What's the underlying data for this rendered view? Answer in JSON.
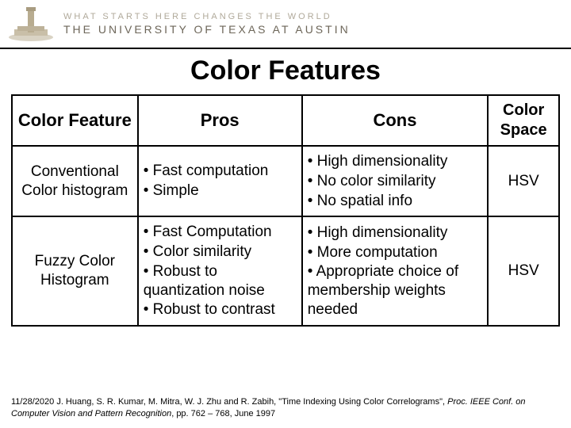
{
  "header": {
    "tagline": "WHAT STARTS HERE CHANGES THE WORLD",
    "university": "THE UNIVERSITY OF TEXAS AT AUSTIN"
  },
  "title": "Color Features",
  "table": {
    "headers": {
      "feature": "Color Feature",
      "pros": "Pros",
      "cons": "Cons",
      "space": "Color Space"
    },
    "rows": [
      {
        "feature": "Conventional Color histogram",
        "pros": [
          "• Fast computation",
          "• Simple"
        ],
        "cons": [
          "• High dimensionality",
          "• No color similarity",
          "• No spatial info"
        ],
        "space": "HSV"
      },
      {
        "feature": "Fuzzy Color Histogram",
        "pros": [
          "• Fast Computation",
          "• Color similarity",
          "• Robust to quantization noise",
          "• Robust to contrast"
        ],
        "cons": [
          "• High dimensionality",
          "• More computation",
          "• Appropriate choice of membership weights needed"
        ],
        "space": "HSV"
      }
    ]
  },
  "footer": {
    "date": "11/28/2020",
    "ref1": "J. Huang, S. R. Kumar, M. Mitra, W. J. Zhu and R. Zabih, \"Time Indexing Using Color Correlograms\", ",
    "ref1_ital": "Proc. IEEE Conf. on Computer Vision and Pattern Recognition",
    "ref2": ", pp. 762 – 768, June 1997"
  }
}
